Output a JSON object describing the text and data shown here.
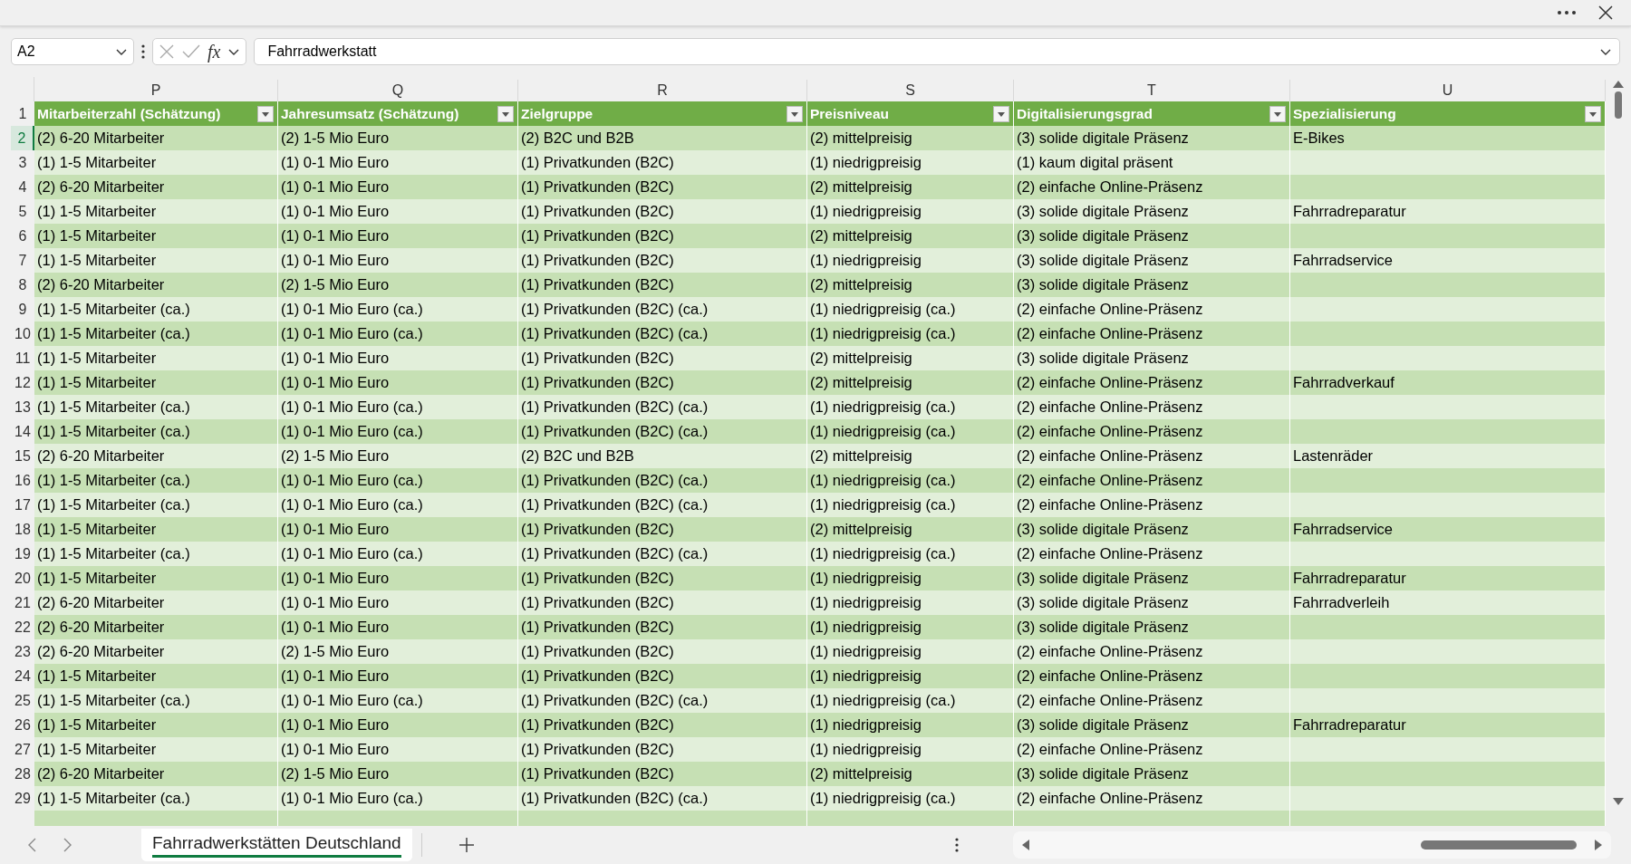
{
  "formula_bar": {
    "name_box": "A2",
    "function_label": "fx",
    "value": "Fahrradwerkstatt"
  },
  "table": {
    "header_row_number": "1",
    "columns": [
      {
        "letter": "P",
        "header": "Mitarbeiterzahl (Schätzung)"
      },
      {
        "letter": "Q",
        "header": "Jahresumsatz (Schätzung)"
      },
      {
        "letter": "R",
        "header": "Zielgruppe"
      },
      {
        "letter": "S",
        "header": "Preisniveau"
      },
      {
        "letter": "T",
        "header": "Digitalisierungsgrad"
      },
      {
        "letter": "U",
        "header": "Spezialisierung"
      }
    ],
    "rows": [
      {
        "number": "2",
        "selected": true,
        "cells": [
          "(2) 6-20 Mitarbeiter",
          "(2) 1-5 Mio Euro",
          "(2) B2C und B2B",
          "(2) mittelpreisig",
          "(3) solide digitale Präsenz",
          "E-Bikes"
        ]
      },
      {
        "number": "3",
        "selected": false,
        "cells": [
          "(1) 1-5 Mitarbeiter",
          "(1) 0-1 Mio Euro",
          "(1) Privatkunden (B2C)",
          "(1) niedrigpreisig",
          "(1) kaum digital präsent"
        ]
      },
      {
        "number": "4",
        "selected": false,
        "cells": [
          "(2) 6-20 Mitarbeiter",
          "(1) 0-1 Mio Euro",
          "(1) Privatkunden (B2C)",
          "(2) mittelpreisig",
          "(2) einfache Online-Präsenz"
        ]
      },
      {
        "number": "5",
        "selected": false,
        "cells": [
          "(1) 1-5 Mitarbeiter",
          "(1) 0-1 Mio Euro",
          "(1) Privatkunden (B2C)",
          "(1) niedrigpreisig",
          "(3) solide digitale Präsenz",
          "Fahrradreparatur"
        ]
      },
      {
        "number": "6",
        "selected": false,
        "cells": [
          "(1) 1-5 Mitarbeiter",
          "(1) 0-1 Mio Euro",
          "(1) Privatkunden (B2C)",
          "(2) mittelpreisig",
          "(3) solide digitale Präsenz"
        ]
      },
      {
        "number": "7",
        "selected": false,
        "cells": [
          "(1) 1-5 Mitarbeiter",
          "(1) 0-1 Mio Euro",
          "(1) Privatkunden (B2C)",
          "(1) niedrigpreisig",
          "(3) solide digitale Präsenz",
          "Fahrradservice"
        ]
      },
      {
        "number": "8",
        "selected": false,
        "cells": [
          "(2) 6-20 Mitarbeiter",
          "(2) 1-5 Mio Euro",
          "(1) Privatkunden (B2C)",
          "(2) mittelpreisig",
          "(3) solide digitale Präsenz"
        ]
      },
      {
        "number": "9",
        "selected": false,
        "cells": [
          "(1) 1-5 Mitarbeiter (ca.)",
          "(1) 0-1 Mio Euro (ca.)",
          "(1) Privatkunden (B2C) (ca.)",
          "(1) niedrigpreisig (ca.)",
          "(2) einfache Online-Präsenz"
        ]
      },
      {
        "number": "10",
        "selected": false,
        "cells": [
          "(1) 1-5 Mitarbeiter (ca.)",
          "(1) 0-1 Mio Euro (ca.)",
          "(1) Privatkunden (B2C) (ca.)",
          "(1) niedrigpreisig (ca.)",
          "(2) einfache Online-Präsenz"
        ]
      },
      {
        "number": "11",
        "selected": false,
        "cells": [
          "(1) 1-5 Mitarbeiter",
          "(1) 0-1 Mio Euro",
          "(1) Privatkunden (B2C)",
          "(2) mittelpreisig",
          "(3) solide digitale Präsenz"
        ]
      },
      {
        "number": "12",
        "selected": false,
        "cells": [
          "(1) 1-5 Mitarbeiter",
          "(1) 0-1 Mio Euro",
          "(1) Privatkunden (B2C)",
          "(2) mittelpreisig",
          "(2) einfache Online-Präsenz",
          "Fahrradverkauf"
        ]
      },
      {
        "number": "13",
        "selected": false,
        "cells": [
          "(1) 1-5 Mitarbeiter (ca.)",
          "(1) 0-1 Mio Euro (ca.)",
          "(1) Privatkunden (B2C) (ca.)",
          "(1) niedrigpreisig (ca.)",
          "(2) einfache Online-Präsenz"
        ]
      },
      {
        "number": "14",
        "selected": false,
        "cells": [
          "(1) 1-5 Mitarbeiter (ca.)",
          "(1) 0-1 Mio Euro (ca.)",
          "(1) Privatkunden (B2C) (ca.)",
          "(1) niedrigpreisig (ca.)",
          "(2) einfache Online-Präsenz"
        ]
      },
      {
        "number": "15",
        "selected": false,
        "cells": [
          "(2) 6-20 Mitarbeiter",
          "(2) 1-5 Mio Euro",
          "(2) B2C und B2B",
          "(2) mittelpreisig",
          "(2) einfache Online-Präsenz",
          "Lastenräder"
        ]
      },
      {
        "number": "16",
        "selected": false,
        "cells": [
          "(1) 1-5 Mitarbeiter (ca.)",
          "(1) 0-1 Mio Euro (ca.)",
          "(1) Privatkunden (B2C) (ca.)",
          "(1) niedrigpreisig (ca.)",
          "(2) einfache Online-Präsenz"
        ]
      },
      {
        "number": "17",
        "selected": false,
        "cells": [
          "(1) 1-5 Mitarbeiter (ca.)",
          "(1) 0-1 Mio Euro (ca.)",
          "(1) Privatkunden (B2C) (ca.)",
          "(1) niedrigpreisig (ca.)",
          "(2) einfache Online-Präsenz"
        ]
      },
      {
        "number": "18",
        "selected": false,
        "cells": [
          "(1) 1-5 Mitarbeiter",
          "(1) 0-1 Mio Euro",
          "(1) Privatkunden (B2C)",
          "(2) mittelpreisig",
          "(3) solide digitale Präsenz",
          "Fahrradservice"
        ]
      },
      {
        "number": "19",
        "selected": false,
        "cells": [
          "(1) 1-5 Mitarbeiter (ca.)",
          "(1) 0-1 Mio Euro (ca.)",
          "(1) Privatkunden (B2C) (ca.)",
          "(1) niedrigpreisig (ca.)",
          "(2) einfache Online-Präsenz"
        ]
      },
      {
        "number": "20",
        "selected": false,
        "cells": [
          "(1) 1-5 Mitarbeiter",
          "(1) 0-1 Mio Euro",
          "(1) Privatkunden (B2C)",
          "(1) niedrigpreisig",
          "(3) solide digitale Präsenz",
          "Fahrradreparatur"
        ]
      },
      {
        "number": "21",
        "selected": false,
        "cells": [
          "(2) 6-20 Mitarbeiter",
          "(1) 0-1 Mio Euro",
          "(1) Privatkunden (B2C)",
          "(1) niedrigpreisig",
          "(3) solide digitale Präsenz",
          "Fahrradverleih"
        ]
      },
      {
        "number": "22",
        "selected": false,
        "cells": [
          "(2) 6-20 Mitarbeiter",
          "(1) 0-1 Mio Euro",
          "(1) Privatkunden (B2C)",
          "(1) niedrigpreisig",
          "(3) solide digitale Präsenz"
        ]
      },
      {
        "number": "23",
        "selected": false,
        "cells": [
          "(2) 6-20 Mitarbeiter",
          "(2) 1-5 Mio Euro",
          "(1) Privatkunden (B2C)",
          "(1) niedrigpreisig",
          "(2) einfache Online-Präsenz"
        ]
      },
      {
        "number": "24",
        "selected": false,
        "cells": [
          "(1) 1-5 Mitarbeiter",
          "(1) 0-1 Mio Euro",
          "(1) Privatkunden (B2C)",
          "(1) niedrigpreisig",
          "(2) einfache Online-Präsenz"
        ]
      },
      {
        "number": "25",
        "selected": false,
        "cells": [
          "(1) 1-5 Mitarbeiter (ca.)",
          "(1) 0-1 Mio Euro (ca.)",
          "(1) Privatkunden (B2C) (ca.)",
          "(1) niedrigpreisig (ca.)",
          "(2) einfache Online-Präsenz"
        ]
      },
      {
        "number": "26",
        "selected": false,
        "cells": [
          "(1) 1-5 Mitarbeiter",
          "(1) 0-1 Mio Euro",
          "(1) Privatkunden (B2C)",
          "(1) niedrigpreisig",
          "(3) solide digitale Präsenz",
          "Fahrradreparatur"
        ]
      },
      {
        "number": "27",
        "selected": false,
        "cells": [
          "(1) 1-5 Mitarbeiter",
          "(1) 0-1 Mio Euro",
          "(1) Privatkunden (B2C)",
          "(1) niedrigpreisig",
          "(2) einfache Online-Präsenz"
        ]
      },
      {
        "number": "28",
        "selected": false,
        "cells": [
          "(2) 6-20 Mitarbeiter",
          "(2) 1-5 Mio Euro",
          "(1) Privatkunden (B2C)",
          "(2) mittelpreisig",
          "(3) solide digitale Präsenz"
        ]
      },
      {
        "number": "29",
        "selected": false,
        "cells": [
          "(1) 1-5 Mitarbeiter (ca.)",
          "(1) 0-1 Mio Euro (ca.)",
          "(1) Privatkunden (B2C) (ca.)",
          "(1) niedrigpreisig (ca.)",
          "(2) einfache Online-Präsenz"
        ]
      }
    ]
  },
  "sheet_tabs": [
    {
      "label": "Fahrradwerkstätten Deutschland",
      "selected": true
    }
  ]
}
